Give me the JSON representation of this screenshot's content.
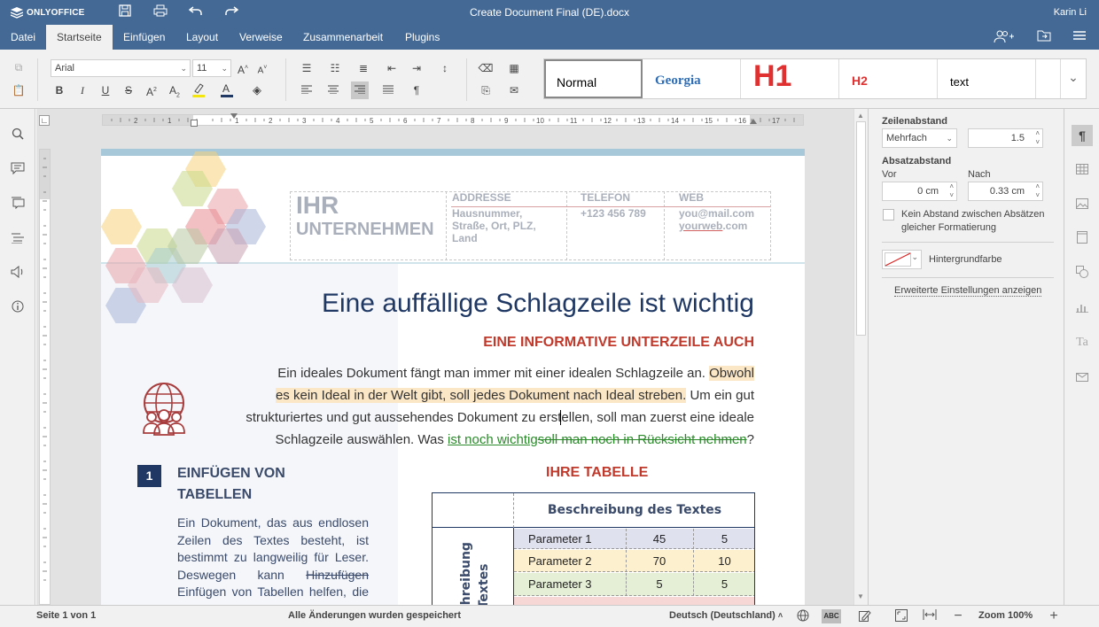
{
  "app": {
    "logo": "ONLYOFFICE",
    "doc_title": "Create Document Final (DE).docx",
    "user": "Karin Li"
  },
  "tabs": [
    "Datei",
    "Startseite",
    "Einfügen",
    "Layout",
    "Verweise",
    "Zusammenarbeit",
    "Plugins"
  ],
  "active_tab": "Startseite",
  "toolbar": {
    "font_name": "Arial",
    "font_size": "11",
    "styles": [
      "Normal",
      "Georgia",
      "H1",
      "H2",
      "text"
    ]
  },
  "document": {
    "company_line1": "IHR",
    "company_line2": "UNTERNEHMEN",
    "addr_label": "ADDRESSE",
    "addr_lines": [
      "Hausnummer,",
      "Straße, Ort, PLZ,",
      "Land"
    ],
    "tel_label": "TELEFON",
    "tel_value": "+123 456 789",
    "web_label": "WEB",
    "web_mail": "you@mail.com",
    "web_site_link": "yourweb",
    "web_site_rest": ".com",
    "headline": "Eine auffällige Schlagzeile ist wichtig",
    "subheadline": "EINE INFORMATIVE UNTERZEILE AUCH",
    "para_l1a": "Ein ideales Dokument fängt man immer mit einer idealen Schlagzeile an. ",
    "para_l1b": "Obwohl",
    "para_l2a": "es kein Ideal in der Welt gibt, soll jedes Dokument nach Ideal streben.",
    "para_l2b": " Um ein gut",
    "para_l3": "strukturiertes und gut aussehendes Dokument zu erstellen, soll man zuerst eine ideale",
    "para_l4a": "Schlagzeile auswählen. Was ",
    "para_l4b": "ist noch wichtig",
    "para_l4c": "soll man noch in Rücksicht nehmen",
    "para_l4d": "?",
    "section_num": "1",
    "section_title_1": "EINFÜGEN VON",
    "section_title_2": "TABELLEN",
    "section_l1": "Ein Dokument, das aus endlosen",
    "section_l2": "Zeilen des Textes besteht, ist",
    "section_l3": "bestimmt zu langweilig für Leser.",
    "section_l4a": "Deswegen kann ",
    "section_l4b": "Hinzufügen",
    "section_l5": "Einfügen von Tabellen helfen, die",
    "table_title": "IHRE TABELLE",
    "table_header": "Beschreibung des Textes",
    "table_vertical": "Beschreibung des Textes",
    "table_rows": [
      {
        "label": "Parameter 1",
        "a": "45",
        "b": "5",
        "color": "#dfe1ef"
      },
      {
        "label": "Parameter 2",
        "a": "70",
        "b": "10",
        "color": "#fdf0cf"
      },
      {
        "label": "Parameter 3",
        "a": "5",
        "b": "5",
        "color": "#e5efd6"
      }
    ]
  },
  "right_panel": {
    "line_spacing_label": "Zeilenabstand",
    "line_spacing_mode": "Mehrfach",
    "line_spacing_value": "1.5",
    "para_spacing_label": "Absatzabstand",
    "before_label": "Vor",
    "after_label": "Nach",
    "before_value": "0 cm",
    "after_value": "0.33 cm",
    "no_space_label": "Kein Abstand zwischen Absätzen gleicher Formatierung",
    "bg_color_label": "Hintergrundfarbe",
    "advanced_link": "Erweiterte Einstellungen anzeigen"
  },
  "status": {
    "page": "Seite 1 von 1",
    "saved": "Alle Änderungen wurden gespeichert",
    "language": "Deutsch (Deutschland)",
    "zoom": "Zoom 100%"
  },
  "colors": {
    "brand": "#446995",
    "accent_red": "#c0392b",
    "navy": "#1f3864"
  }
}
